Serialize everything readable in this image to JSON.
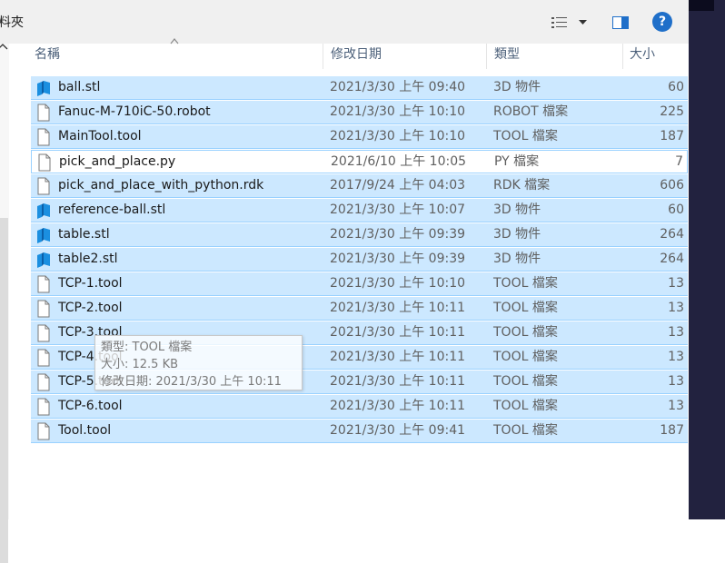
{
  "toolbar": {
    "folder_crumb": "料夾",
    "view_icon": "details-view-icon",
    "dropdown_icon": "dropdown-arrow-icon",
    "preview_icon": "preview-pane-icon",
    "help_label": "?"
  },
  "columns": {
    "name": "名稱",
    "date": "修改日期",
    "type": "類型",
    "size": "大小"
  },
  "files": [
    {
      "name": "ball.stl",
      "date": "2021/3/30 上午 09:40",
      "type": "3D 物件",
      "size": "60",
      "icon": "3d-object-icon",
      "selected": true
    },
    {
      "name": "Fanuc-M-710iC-50.robot",
      "date": "2021/3/30 上午 10:10",
      "type": "ROBOT 檔案",
      "size": "225",
      "icon": "file-icon",
      "selected": true
    },
    {
      "name": "MainTool.tool",
      "date": "2021/3/30 上午 10:10",
      "type": "TOOL 檔案",
      "size": "187",
      "icon": "file-icon",
      "selected": true
    },
    {
      "name": "pick_and_place.py",
      "date": "2021/6/10 上午 10:05",
      "type": "PY 檔案",
      "size": "7",
      "icon": "file-icon",
      "selected": false
    },
    {
      "name": "pick_and_place_with_python.rdk",
      "date": "2017/9/24 上午 04:03",
      "type": "RDK 檔案",
      "size": "606",
      "icon": "file-icon",
      "selected": true
    },
    {
      "name": "reference-ball.stl",
      "date": "2021/3/30 上午 10:07",
      "type": "3D 物件",
      "size": "60",
      "icon": "3d-object-icon",
      "selected": true
    },
    {
      "name": "table.stl",
      "date": "2021/3/30 上午 09:39",
      "type": "3D 物件",
      "size": "264",
      "icon": "3d-object-icon",
      "selected": true
    },
    {
      "name": "table2.stl",
      "date": "2021/3/30 上午 09:39",
      "type": "3D 物件",
      "size": "264",
      "icon": "3d-object-icon",
      "selected": true
    },
    {
      "name": "TCP-1.tool",
      "date": "2021/3/30 上午 10:10",
      "type": "TOOL 檔案",
      "size": "13",
      "icon": "file-icon",
      "selected": true
    },
    {
      "name": "TCP-2.tool",
      "date": "2021/3/30 上午 10:11",
      "type": "TOOL 檔案",
      "size": "13",
      "icon": "file-icon",
      "selected": true
    },
    {
      "name": "TCP-3.tool",
      "date": "2021/3/30 上午 10:11",
      "type": "TOOL 檔案",
      "size": "13",
      "icon": "file-icon",
      "selected": true
    },
    {
      "name": "TCP-4.tool",
      "date": "2021/3/30 上午 10:11",
      "type": "TOOL 檔案",
      "size": "13",
      "icon": "file-icon",
      "selected": true
    },
    {
      "name": "TCP-5.tool",
      "date": "2021/3/30 上午 10:11",
      "type": "TOOL 檔案",
      "size": "13",
      "icon": "file-icon",
      "selected": true
    },
    {
      "name": "TCP-6.tool",
      "date": "2021/3/30 上午 10:11",
      "type": "TOOL 檔案",
      "size": "13",
      "icon": "file-icon",
      "selected": true
    },
    {
      "name": "Tool.tool",
      "date": "2021/3/30 上午 09:41",
      "type": "TOOL 檔案",
      "size": "187",
      "icon": "file-icon",
      "selected": true
    }
  ],
  "tooltip": {
    "type_line": "類型: TOOL 檔案",
    "size_line": "大小: 12.5 KB",
    "date_line": "修改日期: 2021/3/30 上午 10:11"
  },
  "colors": {
    "selection_fill": "#cce8ff",
    "selection_border": "#99d1ff",
    "help_blue": "#1f6fc9",
    "header_text": "#4c607a"
  }
}
